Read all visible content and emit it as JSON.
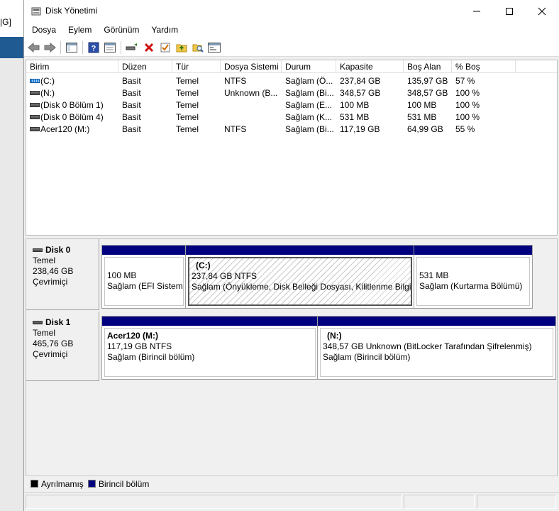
{
  "background": {
    "snippet": "|G]"
  },
  "window": {
    "title": "Disk Yönetimi",
    "minimize": "—",
    "maximize": "☐",
    "close": "✕"
  },
  "menu": [
    "Dosya",
    "Eylem",
    "Görünüm",
    "Yardım"
  ],
  "toolbar": [
    "back-icon",
    "forward-icon",
    "console-tree-icon",
    "help-icon",
    "properties-icon",
    "connect-disk-icon",
    "delete-icon",
    "check-icon",
    "folder-up-icon",
    "search-folder-icon",
    "settings-panel-icon"
  ],
  "columns": [
    "Birim",
    "Düzen",
    "Tür",
    "Dosya Sistemi",
    "Durum",
    "Kapasite",
    "Boş Alan",
    "% Boş"
  ],
  "volumes": [
    {
      "icon": "blue",
      "name": "(C:)",
      "layout": "Basit",
      "type": "Temel",
      "fs": "NTFS",
      "status": "Sağlam (Ö...",
      "capacity": "237,84 GB",
      "free": "135,97 GB",
      "pct": "57 %"
    },
    {
      "icon": "gray",
      "name": "(N:)",
      "layout": "Basit",
      "type": "Temel",
      "fs": "Unknown (B...",
      "status": "Sağlam (Bi...",
      "capacity": "348,57 GB",
      "free": "348,57 GB",
      "pct": "100 %"
    },
    {
      "icon": "gray",
      "name": "(Disk 0 Bölüm 1)",
      "layout": "Basit",
      "type": "Temel",
      "fs": "",
      "status": "Sağlam (E...",
      "capacity": "100 MB",
      "free": "100 MB",
      "pct": "100 %"
    },
    {
      "icon": "gray",
      "name": "(Disk 0 Bölüm 4)",
      "layout": "Basit",
      "type": "Temel",
      "fs": "",
      "status": "Sağlam (K...",
      "capacity": "531 MB",
      "free": "531 MB",
      "pct": "100 %"
    },
    {
      "icon": "gray",
      "name": "Acer120 (M:)",
      "layout": "Basit",
      "type": "Temel",
      "fs": "NTFS",
      "status": "Sağlam (Bi...",
      "capacity": "117,19 GB",
      "free": "64,99 GB",
      "pct": "55 %"
    }
  ],
  "disks": [
    {
      "name": "Disk 0",
      "type": "Temel",
      "size": "238,46 GB",
      "state": "Çevrimiçi",
      "partitions": [
        {
          "name": "",
          "line1": "100 MB",
          "line2": "Sağlam (EFI Sistem Bölümü)"
        },
        {
          "name": "(C:)",
          "line1": "237,84 GB NTFS",
          "line2": "Sağlam (Önyükleme, Disk Belleği Dosyası, Kilitlenme Bilgisi Dökümü, Birincil bölüm)"
        },
        {
          "name": "",
          "line1": "531 MB",
          "line2": "Sağlam (Kurtarma Bölümü)"
        }
      ]
    },
    {
      "name": "Disk 1",
      "type": "Temel",
      "size": "465,76 GB",
      "state": "Çevrimiçi",
      "partitions": [
        {
          "name": "Acer120  (M:)",
          "line1": "117,19 GB NTFS",
          "line2": "Sağlam (Birincil bölüm)"
        },
        {
          "name": "(N:)",
          "line1": "348,57 GB Unknown (BitLocker Tarafından Şifrelenmiş)",
          "line2": "Sağlam (Birincil bölüm)"
        }
      ]
    }
  ],
  "legend": [
    {
      "label": "Ayrılmamış",
      "color": "#000000"
    },
    {
      "label": "Birincil bölüm",
      "color": "#00007f"
    }
  ]
}
